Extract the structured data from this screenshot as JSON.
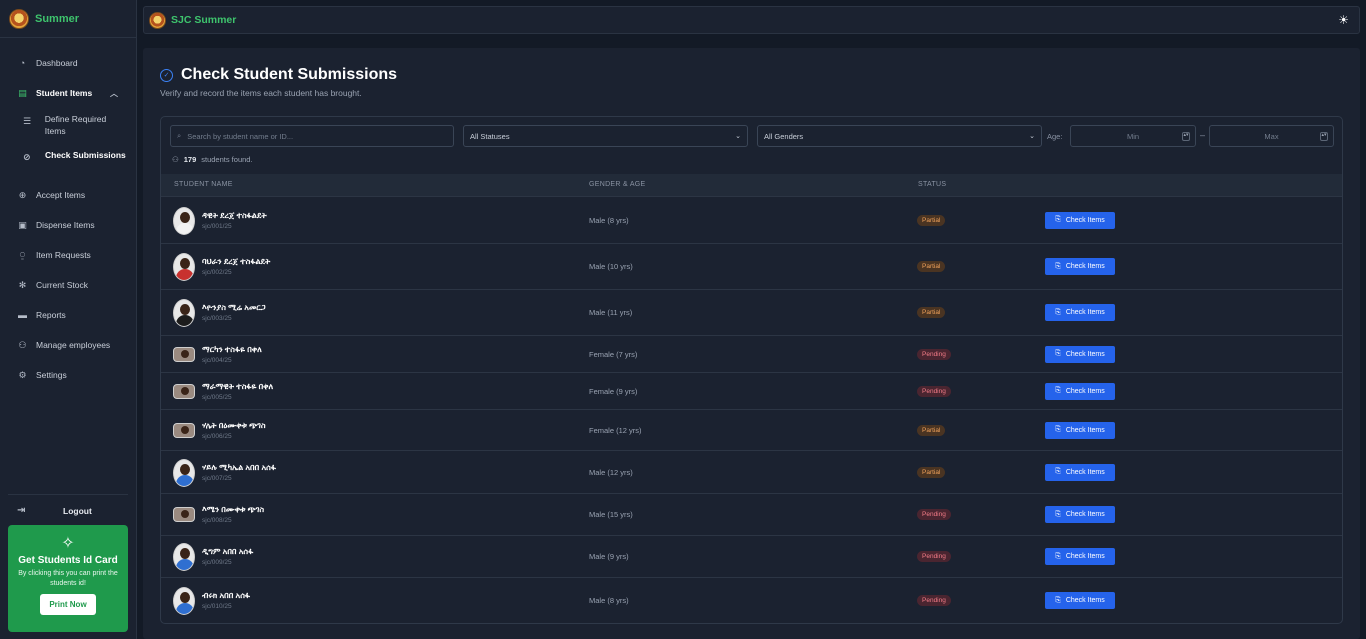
{
  "brand": {
    "name": "Summer",
    "topbar_name": "SJC Summer"
  },
  "sidebar": {
    "items": [
      {
        "label": "Dashboard",
        "icon": "dashboard-icon"
      },
      {
        "label": "Student Items",
        "icon": "box-icon",
        "expanded": true
      },
      {
        "label": "Accept Items",
        "icon": "accept-icon"
      },
      {
        "label": "Dispense Items",
        "icon": "dispense-icon"
      },
      {
        "label": "Item Requests",
        "icon": "request-icon"
      },
      {
        "label": "Current Stock",
        "icon": "stock-icon"
      },
      {
        "label": "Reports",
        "icon": "report-icon"
      },
      {
        "label": "Manage employees",
        "icon": "users-icon"
      },
      {
        "label": "Settings",
        "icon": "gear-icon"
      }
    ],
    "sub_items": [
      {
        "label": "Define Required Items"
      },
      {
        "label": "Check Submissions",
        "active": true
      }
    ],
    "logout_label": "Logout"
  },
  "promo": {
    "title": "Get Students Id Card",
    "description": "By clicking this you can print the students id!",
    "button": "Print Now"
  },
  "page": {
    "title": "Check Student Submissions",
    "subtitle": "Verify and record the items each student has brought."
  },
  "filters": {
    "search_placeholder": "Search by student name or ID...",
    "status_value": "All Statuses",
    "gender_value": "All Genders",
    "age_label": "Age:",
    "min_placeholder": "Min",
    "max_placeholder": "Max",
    "dash": "–"
  },
  "results": {
    "count": "179",
    "suffix": "students found."
  },
  "table": {
    "headers": {
      "name": "STUDENT NAME",
      "gender_age": "GENDER & AGE",
      "status": "STATUS"
    },
    "action_label": "Check Items",
    "rows": [
      {
        "name": "ዳዊት ደረጀ ተስፋልደት",
        "id": "sjc/001/25",
        "gender_age": "Male (8 yrs)",
        "status": "Partial"
      },
      {
        "name": "ባህራን ደረጀ ተስፋልደት",
        "id": "sjc/002/25",
        "gender_age": "Male (10 yrs)",
        "status": "Partial"
      },
      {
        "name": "እዮንያስ ሚሬ አመርጋ",
        "id": "sjc/003/25",
        "gender_age": "Male (11 yrs)",
        "status": "Partial"
      },
      {
        "name": "ማርካን ተስፋዬ በቀለ",
        "id": "sjc/004/25",
        "gender_age": "Female (7 yrs)",
        "status": "Pending"
      },
      {
        "name": "ማራማዊት ተስፋዬ በቀለ",
        "id": "sjc/005/25",
        "gender_age": "Female (9 yrs)",
        "status": "Pending"
      },
      {
        "name": "ሃሌት በዕሙቀቱ ጭገስ",
        "id": "sjc/006/25",
        "gender_age": "Female (12 yrs)",
        "status": "Partial"
      },
      {
        "name": "ሃይሉ ሚካኤል አበበ አሰፋ",
        "id": "sjc/007/25",
        "gender_age": "Male (12 yrs)",
        "status": "Partial"
      },
      {
        "name": "እሜን በሙቀቱ ጭገስ",
        "id": "sjc/008/25",
        "gender_age": "Male (15 yrs)",
        "status": "Pending"
      },
      {
        "name": "ዲግም አበበ አሰፋ",
        "id": "sjc/009/25",
        "gender_age": "Male (9 yrs)",
        "status": "Pending"
      },
      {
        "name": "ብሩክ አበበ አሰፋ",
        "id": "sjc/010/25",
        "gender_age": "Male (8 yrs)",
        "status": "Pending"
      }
    ]
  },
  "colors": {
    "accent": "#3ec46d",
    "primary": "#2563eb",
    "partial": "#f0a15a",
    "pending": "#f27b87"
  }
}
